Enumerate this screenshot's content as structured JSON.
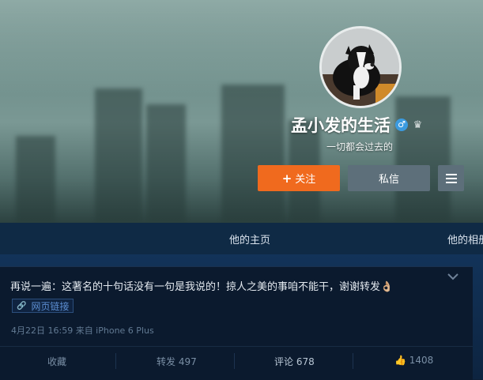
{
  "profile": {
    "name": "孟小发的生活",
    "bio": "一切都会过去的",
    "gender_icon": "male-icon",
    "member_icon": "crown-icon"
  },
  "buttons": {
    "follow": "关注",
    "message": "私信",
    "menu_icon": "hamburger-icon"
  },
  "nav": {
    "tabs": [
      "他的主页",
      "他的相册"
    ]
  },
  "post": {
    "text": "再说一遍：这著名的十句话没有一句是我说的！掠人之美的事咱不能干，谢谢转发👌🏼",
    "link_label": "网页链接",
    "meta": "4月22日 16:59 来自 iPhone 6 Plus",
    "actions": {
      "favorite": "收藏",
      "repost": "转发 497",
      "comment": "评论 678",
      "like": "1408"
    }
  },
  "colors": {
    "follow_button": "#f06a1e",
    "secondary_button": "#5d6f7a",
    "nav_bg": "#0f2a45",
    "card_bg": "#0b1a2e",
    "link_text": "#5d8fd3"
  }
}
